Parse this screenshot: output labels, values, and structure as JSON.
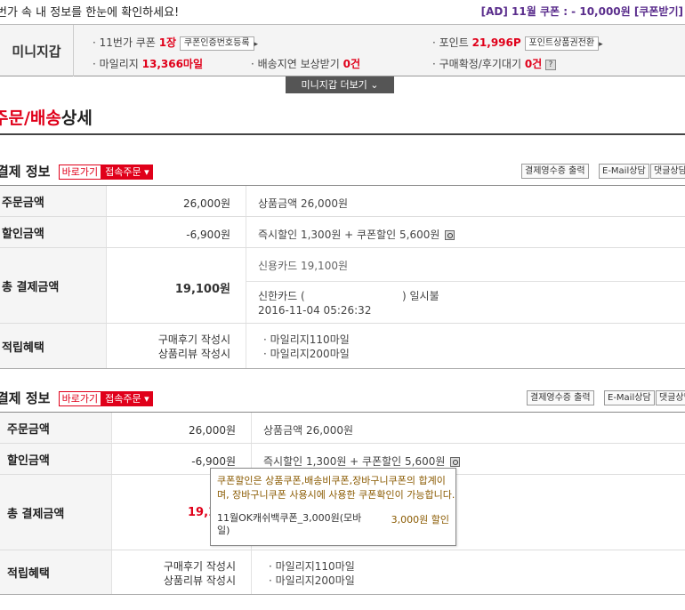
{
  "topbar": {
    "message": "번가 속 내 정보를 한눈에 확인하세요!",
    "ad": "[AD] 11월 쿠폰 : - 10,000원 [쿠폰받기]"
  },
  "wallet": {
    "label": "미니지갑",
    "coupon_label": "· 11번가 쿠폰",
    "coupon_value": "1장",
    "coupon_btn": "쿠폰인증번호등록",
    "point_label": "· 포인트",
    "point_value": "21,996P",
    "point_btn": "포인트상품권전환",
    "mileage_label": "· 마일리지",
    "mileage_value": "13,366마일",
    "delay_label": "· 배송지연 보상받기",
    "delay_value": "0건",
    "confirm_label": "· 구매확정/후기대기",
    "confirm_value": "0건",
    "help_icon": "?",
    "more_btn": "미니지갑 더보기 ⌄"
  },
  "page": {
    "title_prefix": "주문/배송",
    "title_suffix": "상세"
  },
  "sections": [
    {
      "title": "결제 정보",
      "shortcut_btn": "바로가기",
      "order_btn": "접속주문 ▾",
      "receipt_btn": "결제영수증 출력",
      "email_btn": "E-Mail상담",
      "reply_btn": "댓글상담",
      "order_amount_label": "주문금액",
      "order_amount": "26,000원",
      "order_detail": "상품금액 26,000원",
      "discount_label": "할인금액",
      "discount_amount": "-6,900원",
      "discount_detail": "즉시할인 1,300원 + 쿠폰할인 5,600원",
      "total_label": "총 결제금액",
      "total_amount": "19,100원",
      "card_line": "신용카드 19,100원",
      "card_name": "신한카드 (",
      "card_installment": ") 일시불",
      "card_datetime": "2016-11-04 05:26:32",
      "benefit_label": "적립혜택",
      "benefit_1": "구매후기 작성시",
      "benefit_2": "상품리뷰 작성시",
      "benefit_1_value": "· 마일리지110마일",
      "benefit_2_value": "· 마일리지200마일"
    },
    {
      "title": "결제 정보",
      "shortcut_btn": "바로가기",
      "order_btn": "접속주문 ▾",
      "receipt_btn": "결제영수증 출력",
      "email_btn": "E-Mail상담",
      "reply_btn": "댓글상담",
      "order_amount_label": "주문금액",
      "order_amount": "26,000원",
      "order_detail": "상품금액 26,000원",
      "discount_label": "할인금액",
      "discount_amount": "-6,900원",
      "discount_detail": "즉시할인 1,300원 + 쿠폰할인 5,600원",
      "total_label": "총 결제금액",
      "total_amount": "19,1",
      "benefit_label": "적립혜택",
      "benefit_1": "구매후기 작성시",
      "benefit_2": "상품리뷰 작성시",
      "benefit_1_value": "· 마일리지110마일",
      "benefit_2_value": "· 마일리지200마일"
    }
  ],
  "tooltip": {
    "text": "쿠폰할인은 상품쿠폰,배송비쿠폰,장바구니쿠폰의 합계이며, 장바구니쿠폰 사용시에 사용한 쿠폰확인이 가능합니다.",
    "coupon_name": "11월OK캐쉬백쿠폰_3,000원(모바일)",
    "coupon_discount": "3,000원 할인"
  }
}
